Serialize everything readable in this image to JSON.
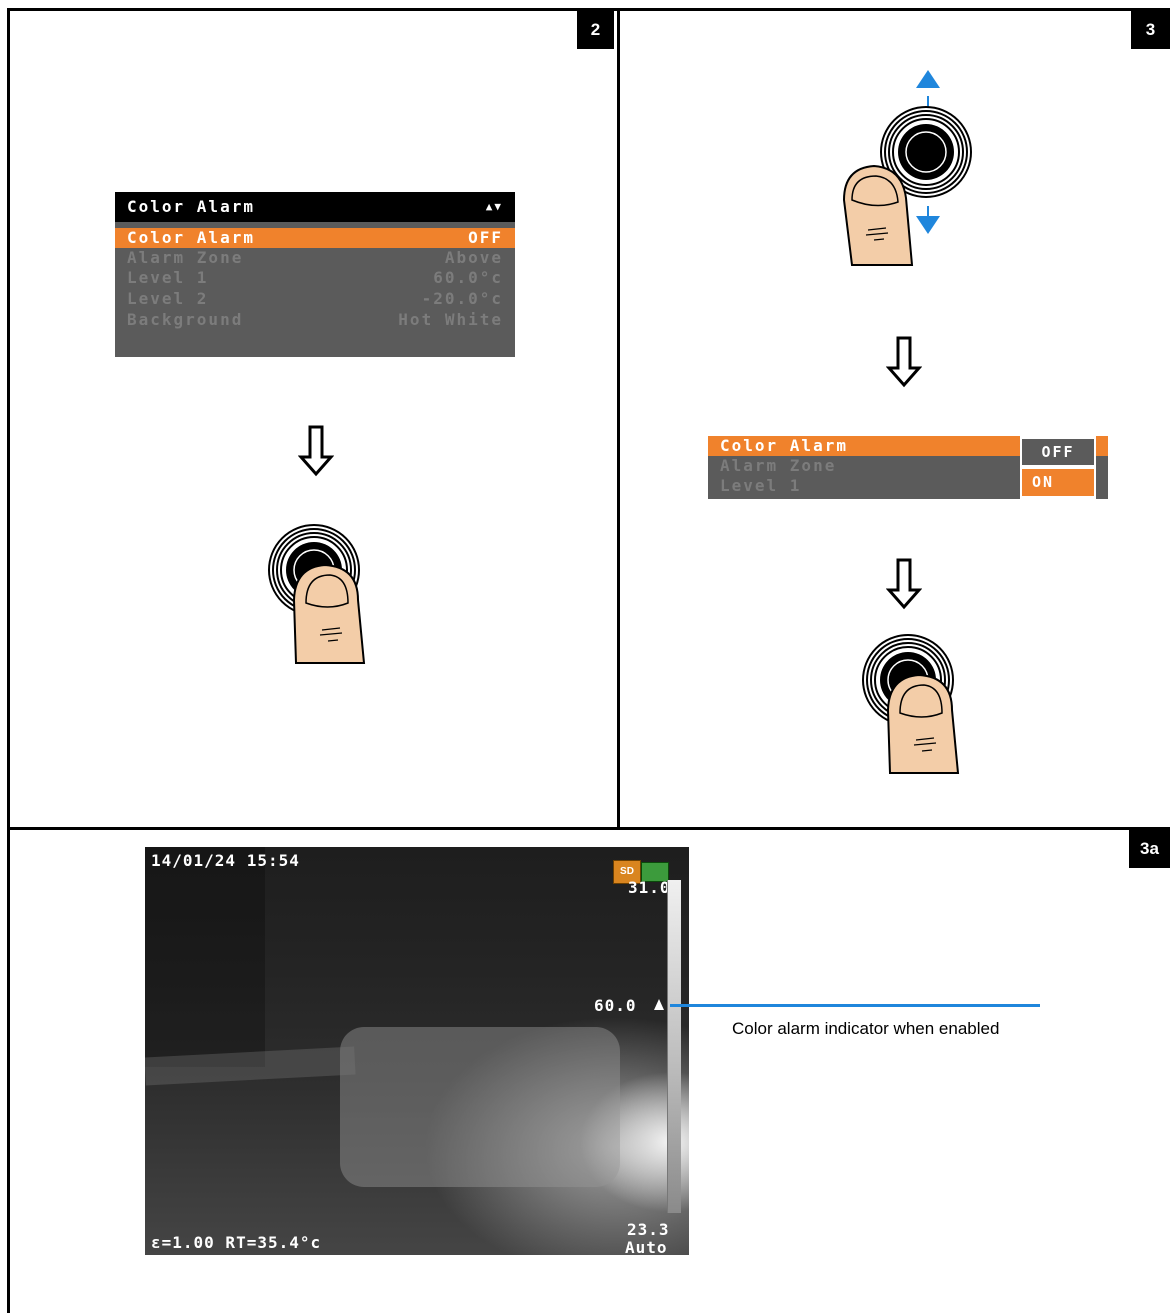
{
  "panels": {
    "p2": {
      "badge": "2"
    },
    "p3": {
      "badge": "3"
    },
    "p3a": {
      "badge": "3a"
    }
  },
  "menu_full": {
    "title": "Color Alarm",
    "title_icon": "updown-icon",
    "rows": [
      {
        "label": "Color Alarm",
        "value": "OFF"
      },
      {
        "label": "Alarm Zone",
        "value": "Above"
      },
      {
        "label": "Level 1",
        "value": "60.0°c"
      },
      {
        "label": "Level 2",
        "value": "-20.0°c"
      },
      {
        "label": "Background",
        "value": "Hot White"
      }
    ]
  },
  "menu_popup": {
    "rows": [
      "Color Alarm",
      "Alarm Zone",
      "Level 1"
    ],
    "options": [
      "OFF",
      "ON"
    ],
    "selected": "ON"
  },
  "thermal": {
    "datetime": "14/01/24 15:54",
    "scale_max": "31.0",
    "alarm_level": "60.0",
    "scale_min": "23.3",
    "range_mode": "Auto",
    "status": "ε=1.00 RT=35.4°c",
    "sd_label": "SD"
  },
  "callout": {
    "text": "Color alarm indicator when enabled"
  },
  "colors": {
    "accent": "#f0822c",
    "menu_bg": "#5b5b5b",
    "arrow_blue": "#1f86dc"
  }
}
